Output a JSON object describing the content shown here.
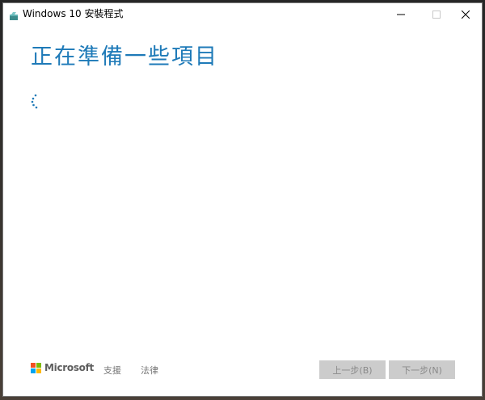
{
  "window": {
    "title": "Windows 10 安裝程式",
    "icon": "setup-box-icon"
  },
  "controls": {
    "minimize_icon": "minimize-icon",
    "maximize_icon": "maximize-icon",
    "close_icon": "close-icon"
  },
  "main": {
    "heading": "正在準備一些項目",
    "spinner_icon": "loading-spinner-icon"
  },
  "footer": {
    "brand": "Microsoft",
    "support_link": "支援",
    "legal_link": "法律",
    "back_button": "上一步(B)",
    "next_button": "下一步(N)"
  },
  "colors": {
    "accent": "#1e7ab8",
    "disabled_button": "#cccccc",
    "ms_red": "#f25022",
    "ms_green": "#7fba00",
    "ms_blue": "#00a4ef",
    "ms_yellow": "#ffb900"
  }
}
